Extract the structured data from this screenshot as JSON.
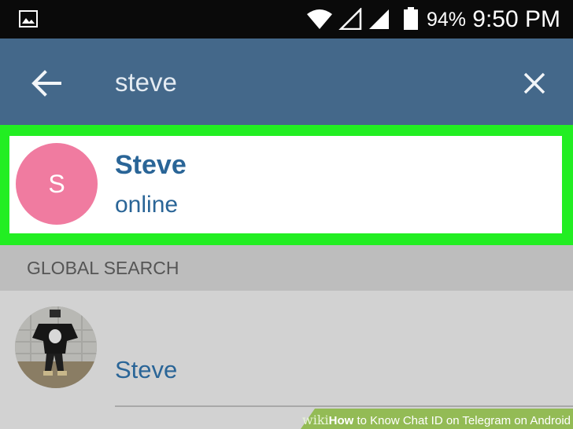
{
  "status_bar": {
    "battery_percent": "94%",
    "time": "9:50 PM",
    "icons": [
      "gallery-icon",
      "wifi-icon",
      "signal-empty-icon",
      "signal-icon",
      "battery-icon"
    ]
  },
  "search": {
    "query": "steve",
    "back_icon": "arrow-left-icon",
    "clear_icon": "close-icon"
  },
  "contact_result": {
    "avatar_letter": "S",
    "name": "Steve",
    "status": "online"
  },
  "global_search": {
    "header": "GLOBAL SEARCH",
    "results": [
      {
        "name": "Steve"
      }
    ]
  },
  "watermark": {
    "brand": "wiki",
    "how": "How",
    "title": " to Know Chat ID on Telegram on Android"
  },
  "colors": {
    "toolbar": "#44688a",
    "highlight": "#22ee22",
    "avatar": "#f07ba0",
    "link_text": "#2a6597"
  }
}
